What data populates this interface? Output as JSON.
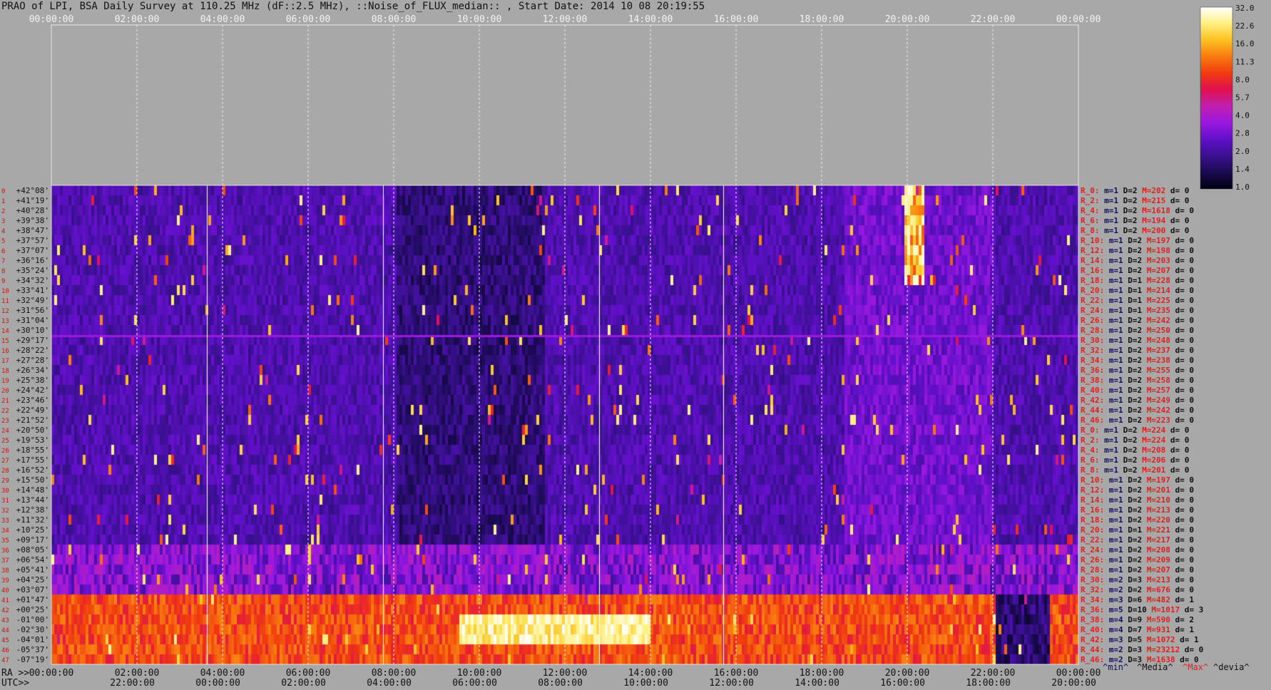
{
  "title": "PRAO of LPI, BSA Daily Survey at 110.25 MHz (dF::2.5 MHz), ::Noise_of_FLUX_median:: , Start Date: 2014 10 08 20:19:55",
  "chart_data": {
    "type": "heatmap",
    "title": "PRAO of LPI, BSA Daily Survey at 110.25 MHz (dF::2.5 MHz), ::Noise_of_FLUX_median:: , Start Date: 2014 10 08 20:19:55",
    "top_time_ticks": [
      "00:00:00",
      "02:00:00",
      "04:00:00",
      "06:00:00",
      "08:00:00",
      "10:00:00",
      "12:00:00",
      "14:00:00",
      "16:00:00",
      "18:00:00",
      "20:00:00",
      "22:00:00",
      "00:00:00"
    ],
    "ra_axis_label": "RA >>",
    "ra_ticks": [
      "00:00:00",
      "02:00:00",
      "04:00:00",
      "06:00:00",
      "08:00:00",
      "10:00:00",
      "12:00:00",
      "14:00:00",
      "16:00:00",
      "18:00:00",
      "20:00:00",
      "22:00:00",
      "00:00:00"
    ],
    "utc_axis_label": "UTC>>",
    "utc_ticks": [
      "22:00:00",
      "00:00:00",
      "02:00:00",
      "04:00:00",
      "06:00:00",
      "08:00:00",
      "10:00:00",
      "12:00:00",
      "14:00:00",
      "16:00:00",
      "18:00:00",
      "20:00:00"
    ],
    "declinations": [
      "+42°08'",
      "+41°19'",
      "+40°28'",
      "+39°38'",
      "+38°47'",
      "+37°57'",
      "+37°07'",
      "+36°16'",
      "+35°24'",
      "+34°32'",
      "+33°41'",
      "+32°49'",
      "+31°56'",
      "+31°04'",
      "+30°10'",
      "+29°17'",
      "+28°22'",
      "+27°28'",
      "+26°34'",
      "+25°38'",
      "+24°42'",
      "+23°46'",
      "+22°49'",
      "+21°52'",
      "+20°50'",
      "+19°53'",
      "+18°55'",
      "+17°55'",
      "+16°52'",
      "+15°50'",
      "+14°48'",
      "+13°44'",
      "+12°38'",
      "+11°32'",
      "+10°25'",
      "+09°17'",
      "+08°05'",
      "+06°54'",
      "+05°41'",
      "+04°25'",
      "+03°07'",
      "+01°47'",
      "+00°25'",
      "-01°00'",
      "-02°30'",
      "-04°01'",
      "-05°37'",
      "-07°19'"
    ],
    "row_numbers": [
      "0",
      "1",
      "2",
      "3",
      "4",
      "5",
      "6",
      "7",
      "8",
      "9",
      "10",
      "11",
      "12",
      "13",
      "14",
      "15",
      "16",
      "17",
      "18",
      "19",
      "20",
      "21",
      "22",
      "23",
      "24",
      "25",
      "26",
      "27",
      "28",
      "29",
      "30",
      "31",
      "32",
      "33",
      "34",
      "35",
      "36",
      "37",
      "38",
      "39",
      "40",
      "41",
      "42",
      "43",
      "44",
      "45",
      "46",
      "47"
    ],
    "row_stats": [
      {
        "r": "R_0:",
        "m": "m=1",
        "D": "D=2",
        "M": "M=202",
        "d": "d= 0"
      },
      {
        "r": "R_2:",
        "m": "m=1",
        "D": "D=2",
        "M": "M=215",
        "d": "d= 0"
      },
      {
        "r": "R_4:",
        "m": "m=1",
        "D": "D=2",
        "M": "M=1618",
        "d": "d= 0"
      },
      {
        "r": "R_6:",
        "m": "m=1",
        "D": "D=2",
        "M": "M=194",
        "d": "d= 0"
      },
      {
        "r": "R_8:",
        "m": "m=1",
        "D": "D=2",
        "M": "M=200",
        "d": "d= 0"
      },
      {
        "r": "R_10:",
        "m": "m=1",
        "D": "D=2",
        "M": "M=197",
        "d": "d= 0"
      },
      {
        "r": "R_12:",
        "m": "m=1",
        "D": "D=2",
        "M": "M=198",
        "d": "d= 0"
      },
      {
        "r": "R_14:",
        "m": "m=1",
        "D": "D=2",
        "M": "M=203",
        "d": "d= 0"
      },
      {
        "r": "R_16:",
        "m": "m=1",
        "D": "D=2",
        "M": "M=207",
        "d": "d= 0"
      },
      {
        "r": "R_18:",
        "m": "m=1",
        "D": "D=1",
        "M": "M=228",
        "d": "d= 0"
      },
      {
        "r": "R_20:",
        "m": "m=1",
        "D": "D=1",
        "M": "M=214",
        "d": "d= 0"
      },
      {
        "r": "R_22:",
        "m": "m=1",
        "D": "D=1",
        "M": "M=225",
        "d": "d= 0"
      },
      {
        "r": "R_24:",
        "m": "m=1",
        "D": "D=1",
        "M": "M=235",
        "d": "d= 0"
      },
      {
        "r": "R_26:",
        "m": "m=1",
        "D": "D=2",
        "M": "M=242",
        "d": "d= 0"
      },
      {
        "r": "R_28:",
        "m": "m=1",
        "D": "D=2",
        "M": "M=250",
        "d": "d= 0"
      },
      {
        "r": "R_30:",
        "m": "m=1",
        "D": "D=2",
        "M": "M=248",
        "d": "d= 0"
      },
      {
        "r": "R_32:",
        "m": "m=1",
        "D": "D=2",
        "M": "M=237",
        "d": "d= 0"
      },
      {
        "r": "R_34:",
        "m": "m=1",
        "D": "D=2",
        "M": "M=238",
        "d": "d= 0"
      },
      {
        "r": "R_36:",
        "m": "m=1",
        "D": "D=2",
        "M": "M=255",
        "d": "d= 0"
      },
      {
        "r": "R_38:",
        "m": "m=1",
        "D": "D=2",
        "M": "M=258",
        "d": "d= 0"
      },
      {
        "r": "R_40:",
        "m": "m=1",
        "D": "D=2",
        "M": "M=257",
        "d": "d= 0"
      },
      {
        "r": "R_42:",
        "m": "m=1",
        "D": "D=2",
        "M": "M=249",
        "d": "d= 0"
      },
      {
        "r": "R_44:",
        "m": "m=1",
        "D": "D=2",
        "M": "M=242",
        "d": "d= 0"
      },
      {
        "r": "R_46:",
        "m": "m=1",
        "D": "D=2",
        "M": "M=223",
        "d": "d= 0"
      },
      {
        "r": "R_0:",
        "m": "m=1",
        "D": "D=2",
        "M": "M=224",
        "d": "d= 0"
      },
      {
        "r": "R_2:",
        "m": "m=1",
        "D": "D=2",
        "M": "M=224",
        "d": "d= 0"
      },
      {
        "r": "R_4:",
        "m": "m=1",
        "D": "D=2",
        "M": "M=208",
        "d": "d= 0"
      },
      {
        "r": "R_6:",
        "m": "m=1",
        "D": "D=2",
        "M": "M=206",
        "d": "d= 0"
      },
      {
        "r": "R_8:",
        "m": "m=1",
        "D": "D=2",
        "M": "M=201",
        "d": "d= 0"
      },
      {
        "r": "R_10:",
        "m": "m=1",
        "D": "D=2",
        "M": "M=197",
        "d": "d= 0"
      },
      {
        "r": "R_12:",
        "m": "m=1",
        "D": "D=2",
        "M": "M=201",
        "d": "d= 0"
      },
      {
        "r": "R_14:",
        "m": "m=1",
        "D": "D=2",
        "M": "M=210",
        "d": "d= 0"
      },
      {
        "r": "R_16:",
        "m": "m=1",
        "D": "D=2",
        "M": "M=213",
        "d": "d= 0"
      },
      {
        "r": "R_18:",
        "m": "m=1",
        "D": "D=2",
        "M": "M=220",
        "d": "d= 0"
      },
      {
        "r": "R_20:",
        "m": "m=1",
        "D": "D=1",
        "M": "M=221",
        "d": "d= 0"
      },
      {
        "r": "R_22:",
        "m": "m=1",
        "D": "D=2",
        "M": "M=217",
        "d": "d= 0"
      },
      {
        "r": "R_24:",
        "m": "m=1",
        "D": "D=2",
        "M": "M=208",
        "d": "d= 0"
      },
      {
        "r": "R_26:",
        "m": "m=1",
        "D": "D=2",
        "M": "M=209",
        "d": "d= 0"
      },
      {
        "r": "R_28:",
        "m": "m=1",
        "D": "D=2",
        "M": "M=207",
        "d": "d= 0"
      },
      {
        "r": "R_30:",
        "m": "m=2",
        "D": "D=3",
        "M": "M=213",
        "d": "d= 0"
      },
      {
        "r": "R_32:",
        "m": "m=2",
        "D": "D=2",
        "M": "M=676",
        "d": "d= 0"
      },
      {
        "r": "R_34:",
        "m": "m=3",
        "D": "D=6",
        "M": "M=482",
        "d": "d= 1"
      },
      {
        "r": "R_36:",
        "m": "m=5",
        "D": "D=10",
        "M": "M=1017",
        "d": "d= 3"
      },
      {
        "r": "R_38:",
        "m": "m=4",
        "D": "D=9",
        "M": "M=590",
        "d": "d= 2"
      },
      {
        "r": "R_40:",
        "m": "m=4",
        "D": "D=7",
        "M": "M=931",
        "d": "d= 1"
      },
      {
        "r": "R_42:",
        "m": "m=3",
        "D": "D=5",
        "M": "M=1072",
        "d": "d= 1"
      },
      {
        "r": "R_44:",
        "m": "m=2",
        "D": "D=3",
        "M": "M=23212",
        "d": "d= 0"
      },
      {
        "r": "R_46:",
        "m": "m=2",
        "D": "D=3",
        "M": "M=1638",
        "d": "d= 0"
      }
    ],
    "legend_labels": {
      "min": "^min^",
      "median": "^Media^",
      "max": "^Max^",
      "devia": "^devia^"
    },
    "colorbar_ticks": [
      "32.0",
      "22.6",
      "16.0",
      "11.3",
      "8.0",
      "5.7",
      "4.0",
      "2.8",
      "2.0",
      "1.4",
      "1.0"
    ],
    "colorbar_colors": [
      "#000010",
      "#1a0a50",
      "#3a1090",
      "#6010c8",
      "#9a18e0",
      "#c020b0",
      "#e01050",
      "#f03a10",
      "#f87a10",
      "#fcc020",
      "#fff080",
      "#ffffff"
    ],
    "scale": "log",
    "bright_bands_ra_hours": [
      {
        "ra_start": 0.0,
        "ra_end": 22.0,
        "dec_start": "+01°47'",
        "dec_end": "-07°19'",
        "level": 11.3
      },
      {
        "ra_start": 9.5,
        "ra_end": 14.0,
        "dec_start": "+00°25'",
        "dec_end": "-02°30'",
        "level": 22.6
      },
      {
        "ra_start": 20.0,
        "ra_end": 20.3,
        "dec_start": "+42°08'",
        "dec_end": "+37°57'",
        "level": 32.0
      }
    ]
  }
}
